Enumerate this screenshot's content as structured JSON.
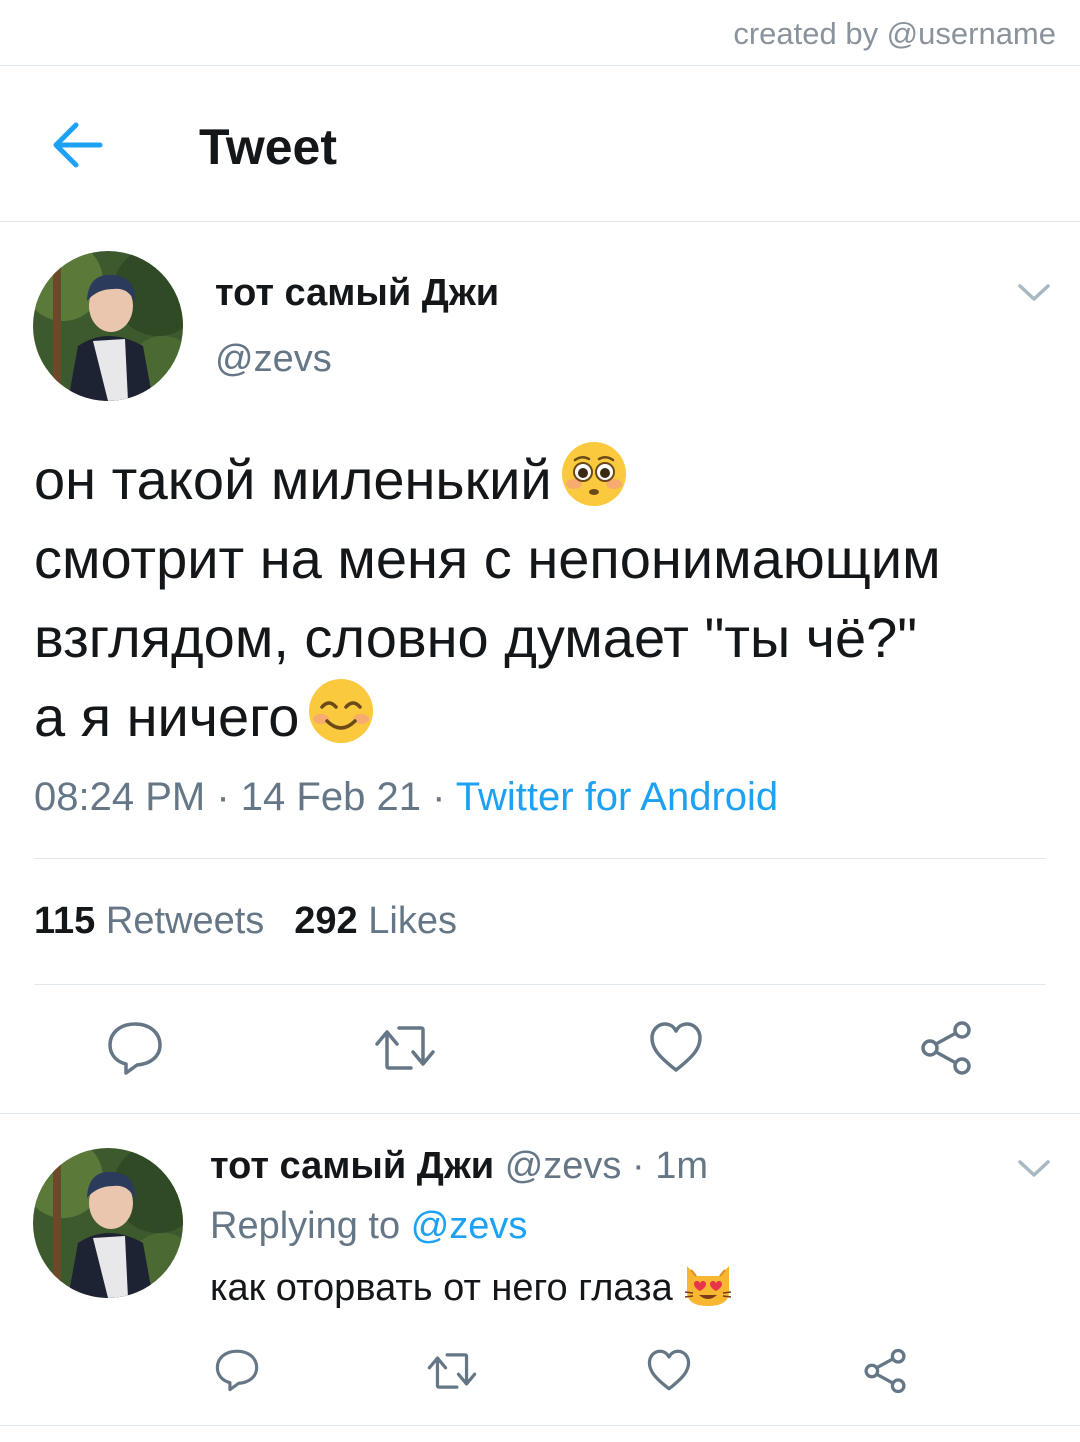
{
  "credit": "created by @username",
  "header": {
    "title": "Tweet"
  },
  "tweet": {
    "author_name": "тот самый Джи",
    "author_handle": "@zevs",
    "lines": [
      "он такой миленький",
      "смотрит на меня с непонимающим",
      "взглядом, словно думает \"ты чё?\"",
      "а я ничего"
    ],
    "emojis": [
      "flushed-face",
      "smiling-face-with-smiling-eyes"
    ],
    "time": "08:24 PM",
    "date": "14 Feb 21",
    "separator": "·",
    "source": "Twitter for Android",
    "retweets_count": "115",
    "retweets_label": "Retweets",
    "likes_count": "292",
    "likes_label": "Likes"
  },
  "reply": {
    "author_name": "тот самый Джи",
    "author_handle": "@zevs",
    "time_ago": "1m",
    "replying_label": "Replying to",
    "replying_handle": "@zevs",
    "text": "как оторвать от него глаза",
    "emoji": "heart-eyes-cat"
  },
  "colors": {
    "accent": "#1da1f2",
    "muted": "#657786",
    "text": "#14171a",
    "divider": "#e1e8ed"
  }
}
